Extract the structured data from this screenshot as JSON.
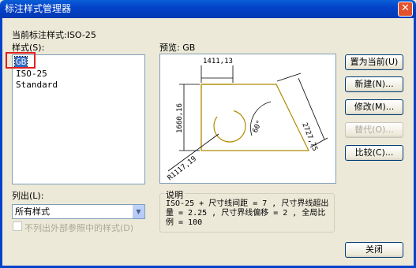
{
  "window": {
    "title": "标注样式管理器",
    "close_glyph": "✕"
  },
  "current_style_label": "当前标注样式:ISO-25",
  "styles": {
    "label": "样式(S):",
    "items": [
      {
        "label": "GB",
        "selected": true
      },
      {
        "label": "ISO-25",
        "selected": false
      },
      {
        "label": "Standard",
        "selected": false
      }
    ]
  },
  "preview": {
    "label": "预览: GB",
    "dims": {
      "top": "1411,13",
      "left": "1660,16",
      "slant": "2727,75",
      "angle": "60°",
      "radius": "R1117,19"
    }
  },
  "buttons": {
    "set_current": "置为当前(U)",
    "new": "新建(N)...",
    "modify": "修改(M)...",
    "override": "替代(O)...",
    "compare": "比较(C)...",
    "close": "关闭"
  },
  "list_filter": {
    "label": "列出(L):",
    "value": "所有样式"
  },
  "exclude_xref": {
    "label": "不列出外部参照中的样式(D)",
    "checked": false,
    "enabled": false
  },
  "description": {
    "title": "说明",
    "text": "ISO-25 + 尺寸线间距 = 7 , 尺寸界线超出量 = 2.25 , 尺寸界线偏移 = 2 , 全局比例 = 100"
  },
  "colors": {
    "title_bar": "#0343c9",
    "selection": "#316ac5",
    "highlight_box": "#e02020",
    "drawing_outline": "#b08a00"
  }
}
